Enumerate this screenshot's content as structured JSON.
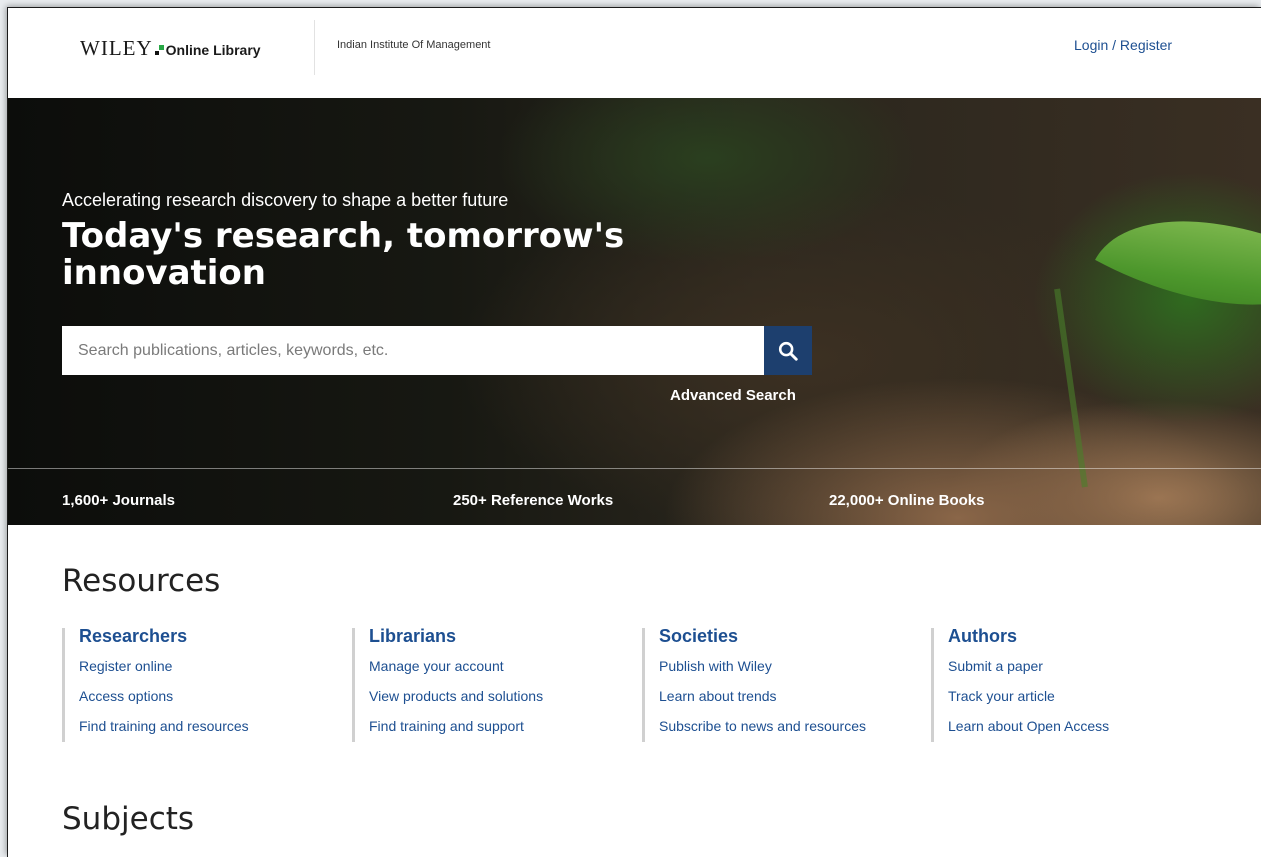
{
  "header": {
    "logo_wiley": "WILEY",
    "logo_online": "Online Library",
    "institution": "Indian Institute Of Management",
    "login": "Login / Register"
  },
  "hero": {
    "subtitle": "Accelerating research discovery to shape a better future",
    "title": "Today's research, tomorrow's innovation",
    "search_placeholder": "Search publications, articles, keywords, etc.",
    "search_icon": "search-icon",
    "advanced_search": "Advanced Search",
    "stats": [
      "1,600+ Journals",
      "250+ Reference Works",
      "22,000+ Online Books"
    ]
  },
  "resources": {
    "title": "Resources",
    "columns": [
      {
        "heading": "Researchers",
        "links": [
          "Register online",
          "Access options",
          "Find training and resources"
        ]
      },
      {
        "heading": "Librarians",
        "links": [
          "Manage your account",
          "View products and solutions",
          "Find training and support"
        ]
      },
      {
        "heading": "Societies",
        "links": [
          "Publish with Wiley",
          "Learn about trends",
          "Subscribe to news and resources"
        ]
      },
      {
        "heading": "Authors",
        "links": [
          "Submit a paper",
          "Track your article",
          "Learn about Open Access"
        ]
      }
    ]
  },
  "subjects": {
    "title": "Subjects"
  },
  "colors": {
    "link": "#1d4f91",
    "search_button": "#1d3f6e",
    "logo_accent": "#28a745"
  }
}
